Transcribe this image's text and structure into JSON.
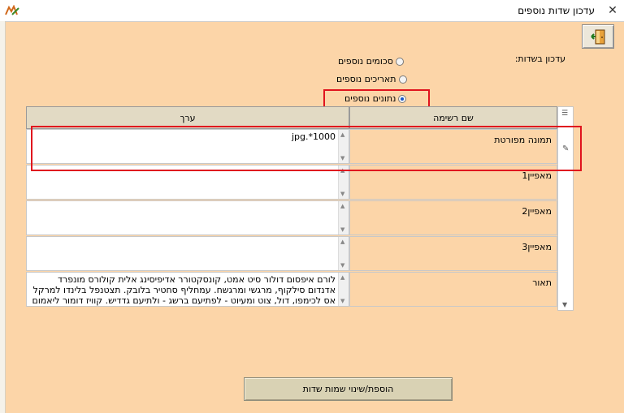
{
  "window": {
    "title": "עדכון שדות נוספים",
    "close_glyph": "✕"
  },
  "exit_button": {
    "icon": "exit-door-icon"
  },
  "update_fields_label": "עדכון בשדות:",
  "radios": [
    {
      "label": "סכומים נוספים",
      "checked": false
    },
    {
      "label": "תאריכים נוספים",
      "checked": false
    },
    {
      "label": "נתונים נוספים",
      "checked": true
    }
  ],
  "table": {
    "headers": {
      "value": "ערך",
      "name": "שם רשימה"
    },
    "rows": [
      {
        "name": "תמונה מפורטת",
        "value": "1000*.jpg"
      },
      {
        "name": "מאפיין1",
        "value": ""
      },
      {
        "name": "מאפיין2",
        "value": ""
      },
      {
        "name": "מאפיין3",
        "value": ""
      },
      {
        "name": "תאור",
        "value": "לורם איפסום דולור סיט אמט, קונסקטורר אדיפיסינג אלית קולורס מונפרד אדנדום סילקוף, מרגשי ומרגשח. עמחליף סחטיר בלובק. תצטנפל בלינדו למרקל אס לכימפו, דול, צוט ומעיוט - לפתיעם ברשג - ולתיעם גדדיש. קוויז דומור ליאמום בלינך רוגצה."
      }
    ]
  },
  "add_button_label": "הוספת/שינוי שמות שדות",
  "colors": {
    "background": "#fcd5a8",
    "highlight": "#e0141e",
    "header": "#e2dac4",
    "button": "#d9d2b4"
  }
}
